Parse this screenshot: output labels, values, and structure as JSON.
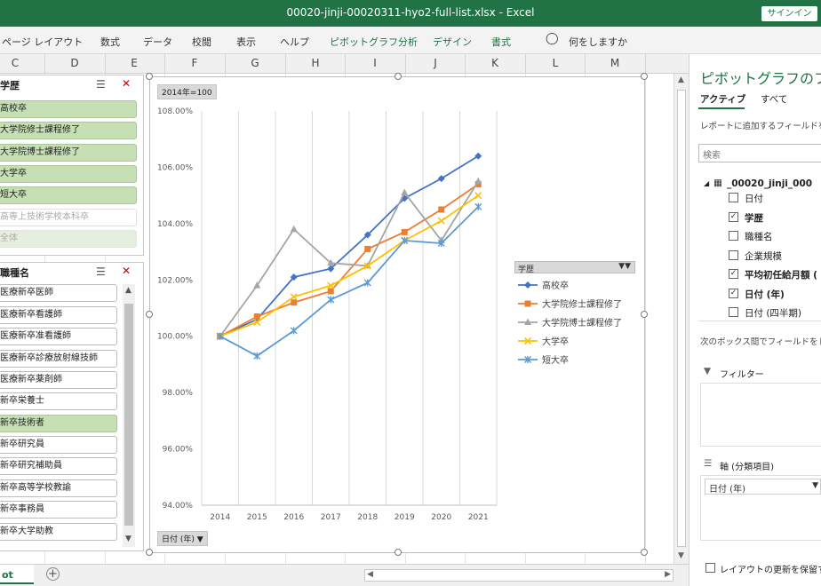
{
  "window": {
    "title": "00020-jinji-00020311-hyo2-full-list.xlsx  -  Excel",
    "signin": "サインイン"
  },
  "ribbon": {
    "tabs": [
      "ページ レイアウト",
      "数式",
      "データ",
      "校閲",
      "表示",
      "ヘルプ",
      "ピボットグラフ分析",
      "デザイン",
      "書式"
    ],
    "tell_me": "何をしますか"
  },
  "columns": [
    "C",
    "D",
    "E",
    "F",
    "G",
    "H",
    "I",
    "J",
    "K",
    "L",
    "M"
  ],
  "slicer1": {
    "header": "学歴",
    "items": [
      "高校卒",
      "大学院修士課程修了",
      "大学院博士課程修了",
      "大学卒",
      "短大卒",
      "高専上技術学校本科卒",
      "全体"
    ]
  },
  "slicer2": {
    "header": "職種名",
    "items": [
      "医療新卒医師",
      "医療新卒看護師",
      "医療新卒准看護師",
      "医療新卒診療放射線技師",
      "医療新卒薬剤師",
      "新卒栄養士",
      "新卒技術者",
      "新卒研究員",
      "新卒研究補助員",
      "新卒高等学校教諭",
      "新卒事務員",
      "新卒大学助教"
    ]
  },
  "chart": {
    "field_button": "2014年=100",
    "axis_button": "日付 (年)",
    "legend_title": "学歴"
  },
  "chart_data": {
    "type": "line",
    "x": [
      2014,
      2015,
      2016,
      2017,
      2018,
      2019,
      2020,
      2021
    ],
    "ylim": [
      94,
      108
    ],
    "yticks": [
      "94.00%",
      "96.00%",
      "98.00%",
      "100.00%",
      "102.00%",
      "104.00%",
      "106.00%",
      "108.00%"
    ],
    "series": [
      {
        "name": "高校卒",
        "color": "#4472c4",
        "marker": "diamond",
        "values": [
          100.0,
          100.6,
          102.1,
          102.4,
          103.6,
          104.9,
          105.6,
          106.4
        ]
      },
      {
        "name": "大学院修士課程修了",
        "color": "#ed7d31",
        "marker": "square",
        "values": [
          100.0,
          100.7,
          101.2,
          101.6,
          103.1,
          103.7,
          104.5,
          105.4
        ]
      },
      {
        "name": "大学院博士課程修了",
        "color": "#a5a5a5",
        "marker": "triangle",
        "values": [
          100.0,
          101.8,
          103.8,
          102.6,
          102.5,
          105.1,
          103.4,
          105.5
        ]
      },
      {
        "name": "大学卒",
        "color": "#ffc000",
        "marker": "x",
        "values": [
          100.0,
          100.5,
          101.4,
          101.8,
          102.5,
          103.4,
          104.1,
          105.0
        ]
      },
      {
        "name": "短大卒",
        "color": "#5b9bd5",
        "marker": "star",
        "values": [
          100.0,
          99.3,
          100.2,
          101.3,
          101.9,
          103.4,
          103.3,
          104.6
        ]
      }
    ]
  },
  "pane": {
    "title": "ピボットグラフのフィ",
    "tab_active": "アクティブ",
    "tab_all": "すべて",
    "hint": "レポートに追加するフィールドを選",
    "search": "検索",
    "table": "_00020_jinji_000",
    "fields": [
      {
        "label": "日付",
        "checked": false,
        "bold": false
      },
      {
        "label": "学歴",
        "checked": true,
        "bold": true
      },
      {
        "label": "職種名",
        "checked": false,
        "bold": false
      },
      {
        "label": "企業規模",
        "checked": false,
        "bold": false
      },
      {
        "label": "平均初任給月額 (",
        "checked": true,
        "bold": true
      },
      {
        "label": "日付 (年)",
        "checked": true,
        "bold": true
      },
      {
        "label": "日付 (四半期)",
        "checked": false,
        "bold": false
      }
    ],
    "drag_hint": "次のボックス間でフィールドをドラ",
    "filter_label": "フィルター",
    "axis_label": "軸 (分類項目)",
    "axis_value": "日付 (年)",
    "defer": "レイアウトの更新を保留す"
  },
  "sheet": {
    "tab": "ot"
  }
}
